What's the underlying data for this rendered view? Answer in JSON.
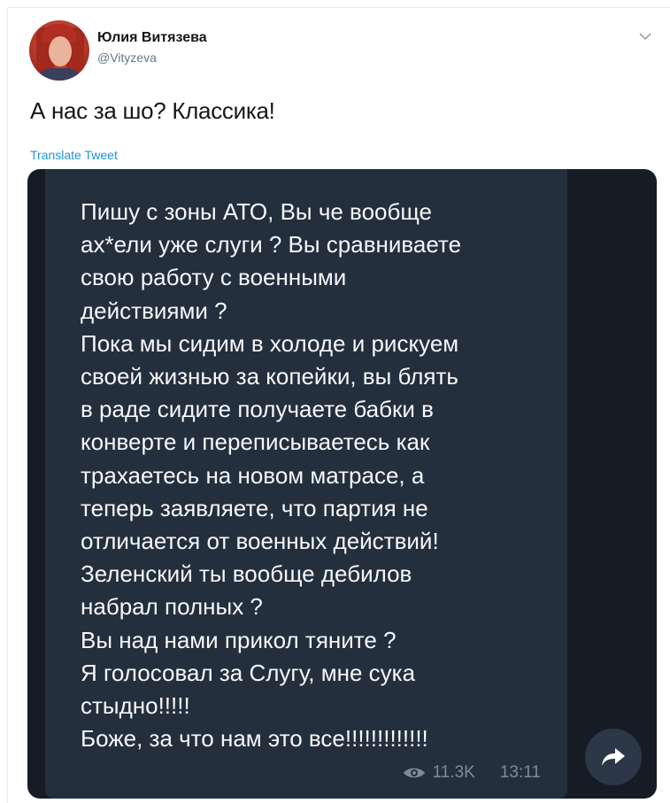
{
  "tweet": {
    "author_name": "Юлия Витязева",
    "author_handle": "@Vityzeva",
    "text": "А нас за шо? Классика!",
    "translate_label": "Translate Tweet"
  },
  "media": {
    "message": "Пишу с зоны АТО, Вы че вообще\nах*ели уже слуги ? Вы сравниваете\nсвою работу с военными\nдействиями ?\nПока мы сидим в холоде и рискуем\nсвоей жизнью за копейки, вы блять\nв раде сидите получаете бабки в\nконверте и переписываетесь как\nтрахаетесь на новом матрасе, а\nтеперь заявляете, что партия не\nотличается от военных действий!\nЗеленский ты вообще дебилов\nнабрал полных ?\nВы над нами прикол тяните ?\nЯ голосовал за Слугу, мне сука\nстыдно!!!!!\nБоже, за что нам это все!!!!!!!!!!!!!",
    "views": "11.3K",
    "time": "13:11"
  },
  "icons": [
    "eye-icon",
    "share-arrow-icon",
    "chevron-down-icon"
  ],
  "colors": {
    "link": "#1b95e0",
    "media_bg": "#161c26",
    "bubble_bg": "#242f3d"
  }
}
